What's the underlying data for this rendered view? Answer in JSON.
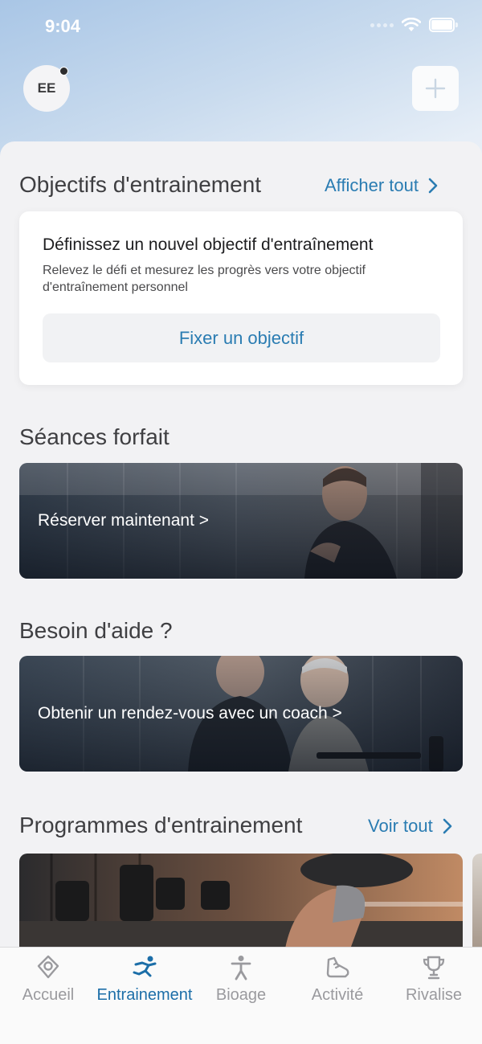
{
  "status_bar": {
    "time": "9:04"
  },
  "header": {
    "avatar_initials": "EE"
  },
  "goals": {
    "title": "Objectifs d'entrainement",
    "link_label": "Afficher tout",
    "card_title": "Définissez un nouvel objectif d'entraînement",
    "card_description": "Relevez le défi et mesurez les progrès vers votre objectif d'entraînement personnel",
    "button_label": "Fixer un objectif"
  },
  "sessions": {
    "title": "Séances forfait",
    "banner_label": "Réserver maintenant >"
  },
  "help": {
    "title": "Besoin d'aide ?",
    "banner_label": "Obtenir un rendez-vous avec un coach >"
  },
  "programs": {
    "title": "Programmes d'entrainement",
    "link_label": "Voir tout"
  },
  "tab_bar": {
    "tabs": [
      {
        "label": "Accueil",
        "icon": "location-pin-icon"
      },
      {
        "label": "Entrainement",
        "icon": "runner-icon",
        "active": true
      },
      {
        "label": "Bioage",
        "icon": "person-icon"
      },
      {
        "label": "Activité",
        "icon": "shoe-icon"
      },
      {
        "label": "Rivalise",
        "icon": "trophy-icon"
      }
    ]
  },
  "colors": {
    "accent": "#2a7cb2",
    "active_tab": "#1c6ea8",
    "inactive_tab": "#9a9a9e"
  }
}
